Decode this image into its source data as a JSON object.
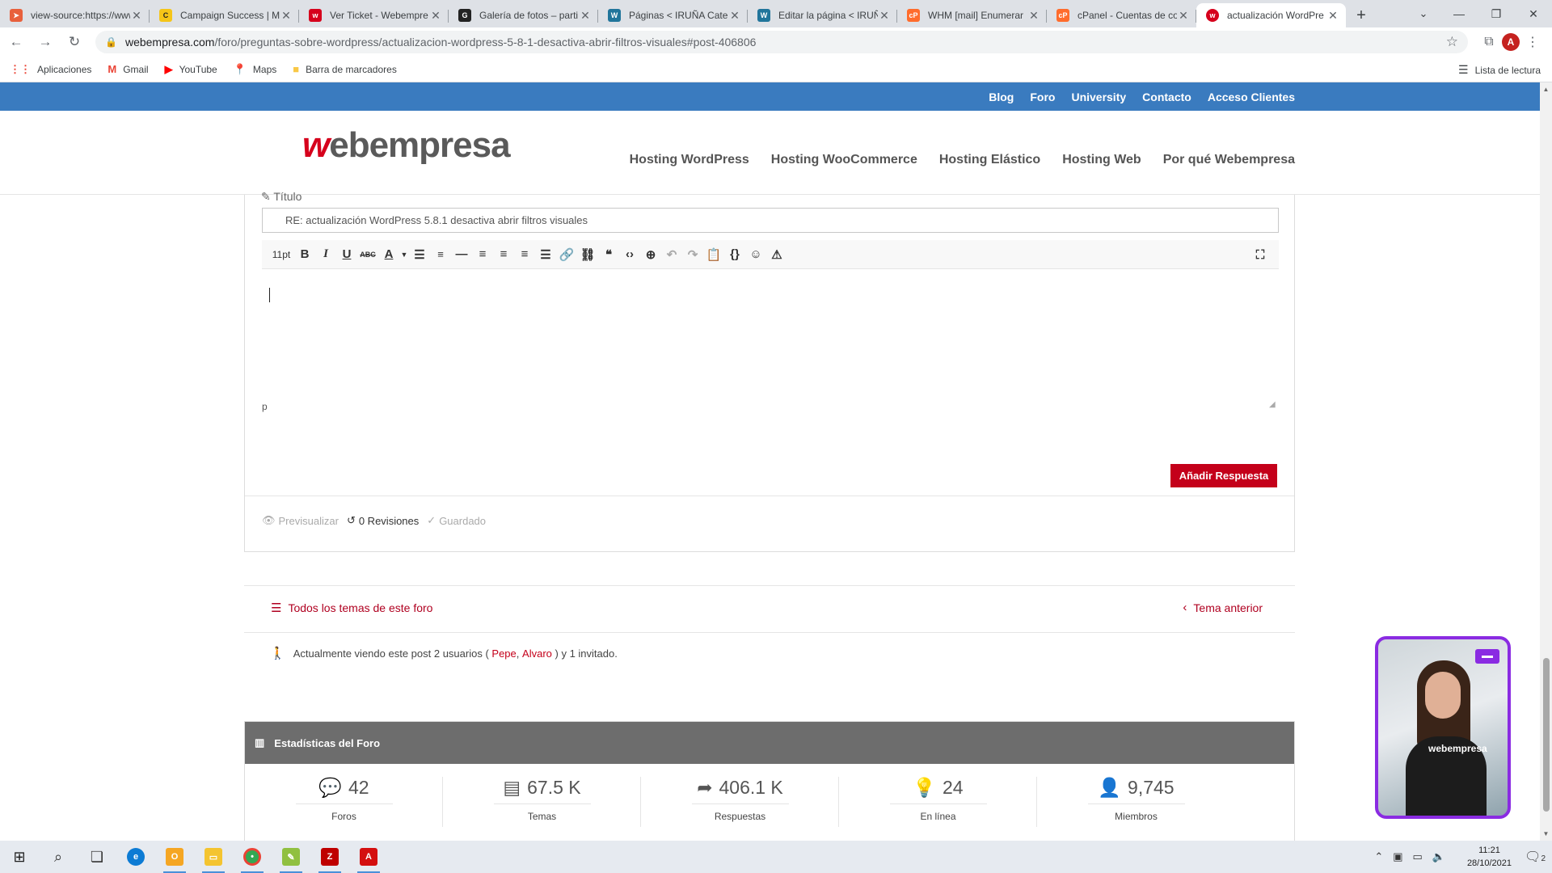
{
  "browser": {
    "tabs": [
      {
        "title": "view-source:https://www...",
        "favicon_color": "#e8603c",
        "favicon_glyph": "➤"
      },
      {
        "title": "Campaign Success | M",
        "favicon_color": "#f5c518",
        "favicon_glyph": "C"
      },
      {
        "title": "Ver Ticket - Webempre",
        "favicon_color": "#d6001c",
        "favicon_glyph": "w"
      },
      {
        "title": "Galería de fotos – parti",
        "favicon_color": "#222222",
        "favicon_glyph": "G"
      },
      {
        "title": "Páginas < IRUÑA Cate",
        "favicon_color": "#21759b",
        "favicon_glyph": "W"
      },
      {
        "title": "Editar la página < IRUÑ",
        "favicon_color": "#21759b",
        "favicon_glyph": "W"
      },
      {
        "title": "WHM [mail] Enumerar",
        "favicon_color": "#ff6c2c",
        "favicon_glyph": "cP"
      },
      {
        "title": "cPanel - Cuentas de co",
        "favicon_color": "#ff6c2c",
        "favicon_glyph": "cP"
      },
      {
        "title": "actualización WordPre",
        "favicon_color": "#d6001c",
        "favicon_glyph": "w"
      }
    ],
    "url_host": "webempresa.com",
    "url_path": "/foro/preguntas-sobre-wordpress/actualizacion-wordpress-5-8-1-desactiva-abrir-filtros-visuales#post-406806",
    "profile_initial": "A",
    "bookmarks": [
      {
        "label": "Aplicaciones",
        "icon": "apps-grid-icon",
        "color": "#ea4335"
      },
      {
        "label": "Gmail",
        "icon": "gmail-icon",
        "color": "#ea4335"
      },
      {
        "label": "YouTube",
        "icon": "youtube-icon",
        "color": "#ff0000"
      },
      {
        "label": "Maps",
        "icon": "maps-pin-icon",
        "color": "#34a853"
      },
      {
        "label": "Barra de marcadores",
        "icon": "folder-icon",
        "color": "#f9c846"
      }
    ],
    "reading_list": "Lista de lectura"
  },
  "site": {
    "top_links": [
      "Blog",
      "Foro",
      "University",
      "Contacto",
      "Acceso Clientes"
    ],
    "logo_w": "w",
    "logo_rest": "ebempresa",
    "main_nav": [
      "Hosting WordPress",
      "Hosting WooCommerce",
      "Hosting Elástico",
      "Hosting Web",
      "Por qué Webempresa"
    ]
  },
  "reply_form": {
    "title_label": "Título",
    "title_value": "RE: actualización WordPress 5.8.1 desactiva abrir filtros visuales",
    "font_size": "11pt",
    "path": "p",
    "submit": "Añadir Respuesta",
    "preview": "Previsualizar",
    "revisions": "0 Revisiones",
    "saved": "Guardado"
  },
  "forum_nav": {
    "all_topics": "Todos los temas de este foro",
    "prev_topic": "Tema anterior"
  },
  "viewing": {
    "prefix": "Actualmente viendo este post 2 usuarios (",
    "user1": "Pepe",
    "sep": ",",
    "user2": "Alvaro",
    "suffix": ") y 1 invitado."
  },
  "stats": {
    "heading": "Estadísticas del Foro",
    "items": [
      {
        "value": "42",
        "label": "Foros",
        "icon": "comments-icon"
      },
      {
        "value": "67.5 K",
        "label": "Temas",
        "icon": "document-icon"
      },
      {
        "value": "406.1 K",
        "label": "Respuestas",
        "icon": "reply-arrow-icon"
      },
      {
        "value": "24",
        "label": "En línea",
        "icon": "lightbulb-icon"
      },
      {
        "value": "9,745",
        "label": "Miembros",
        "icon": "user-icon"
      }
    ]
  },
  "video_widget": {
    "brand": "webempresa"
  },
  "taskbar": {
    "time": "11:21",
    "date": "28/10/2021",
    "notifications": "2"
  }
}
